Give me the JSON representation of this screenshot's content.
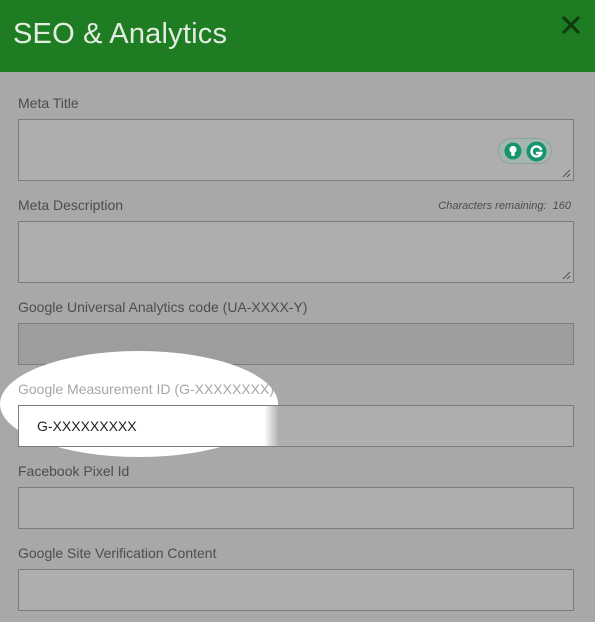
{
  "header": {
    "title": "SEO & Analytics",
    "close_icon": "close-icon"
  },
  "fields": {
    "meta_title": {
      "label": "Meta Title",
      "value": ""
    },
    "meta_description": {
      "label": "Meta Description",
      "value": "",
      "chars_remaining_label": "Characters remaining:",
      "chars_remaining_count": "160"
    },
    "ua_code": {
      "label": "Google Universal Analytics code (UA-XXXX-Y)",
      "value": ""
    },
    "measurement_id": {
      "label": "Google Measurement ID (G-XXXXXXXX)",
      "value": "G-XXXXXXXXX"
    },
    "facebook_pixel": {
      "label": "Facebook Pixel Id",
      "value": ""
    },
    "site_verification": {
      "label": "Google Site Verification Content",
      "value": ""
    }
  },
  "grammarly": {
    "bulb_icon": "lightbulb-icon",
    "logo_icon": "grammarly-icon"
  },
  "colors": {
    "header_bg": "#1e7d22",
    "overlay": "#a8a8a8",
    "spotlight": "#ffffff",
    "grammarly_accent": "#15946f"
  }
}
